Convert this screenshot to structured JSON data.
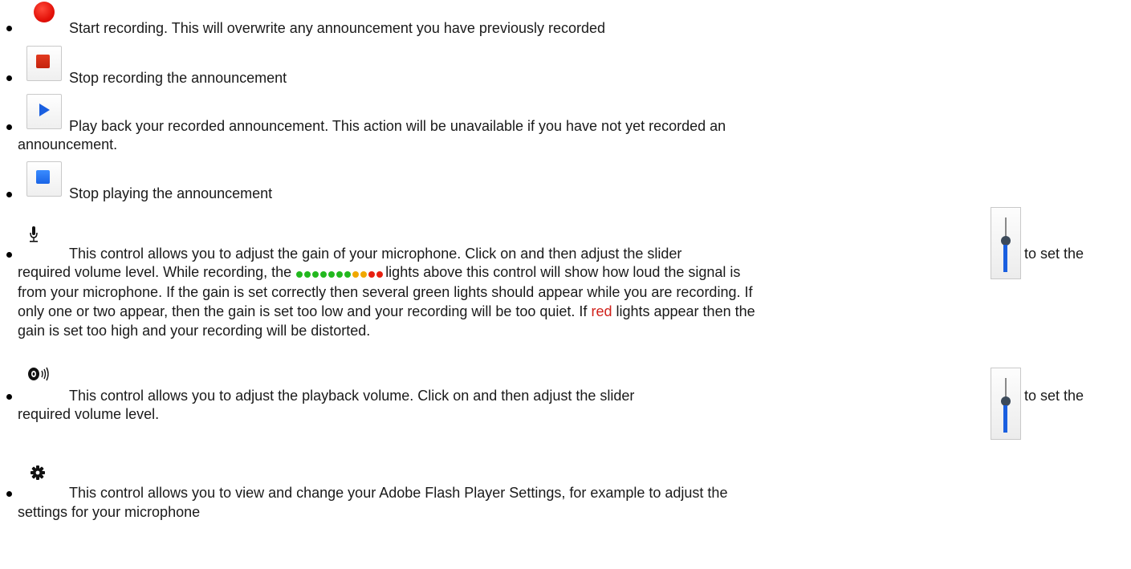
{
  "items": [
    {
      "id": "start-recording",
      "icon": "record-dot-icon",
      "lines": [
        "Start recording. This will overwrite any announcement you have previously recorded"
      ]
    },
    {
      "id": "stop-recording",
      "icon": "stop-recording-icon",
      "lines": [
        "Stop recording the announcement"
      ]
    },
    {
      "id": "play-back",
      "icon": "play-icon",
      "lines": [
        "Play back your recorded announcement. This action will be unavailable if you have not yet recorded an",
        "announcement."
      ]
    },
    {
      "id": "stop-playing",
      "icon": "stop-playing-icon",
      "lines": [
        "Stop playing the announcement"
      ]
    },
    {
      "id": "microphone-gain",
      "icon": "microphone-icon",
      "line1_pre": "This control allows you to adjust the gain of your microphone. Click on and then adjust the slider",
      "line1_post": "to set the",
      "line2_pre": "required volume level. While recording, the",
      "line2_post": "lights above this control will show how loud the signal is",
      "line3": "from your microphone. If the gain is set correctly then several green lights should appear while you are recording. If",
      "line4_pre": "only one or two appear, then the gain is set too low and your recording will be too quiet. If",
      "line4_red": "red",
      "line4_post": "lights appear then the",
      "line5": "gain is set too high and your recording will be distorted.",
      "led_colors": [
        "#22b81e",
        "#22b81e",
        "#22b81e",
        "#22b81e",
        "#22b81e",
        "#22b81e",
        "#22b81e",
        "#f0a800",
        "#f0a800",
        "#e82010",
        "#e82010"
      ]
    },
    {
      "id": "playback-volume",
      "icon": "speaker-icon",
      "line1_pre": "This control allows you to adjust the playback volume. Click on and then adjust the slider",
      "line1_post": "to set the",
      "line2": "required volume level."
    },
    {
      "id": "flash-settings",
      "icon": "gear-icon",
      "lines": [
        "This control allows you to view and change your Adobe Flash Player Settings, for example to adjust the",
        "settings for your microphone"
      ]
    }
  ],
  "colors": {
    "record": "#e4130a",
    "stop_record": "#c4230d",
    "play": "#1a5fe0",
    "stop_play": "#2a78f5",
    "slider_track": "#1a5fe0",
    "led_green": "#22b81e",
    "led_orange": "#f0a800",
    "led_red": "#e82010"
  }
}
